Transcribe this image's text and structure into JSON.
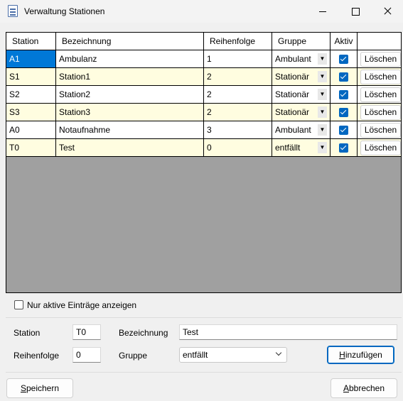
{
  "window": {
    "title": "Verwaltung Stationen"
  },
  "grid": {
    "headers": [
      "Station",
      "Bezeichnung",
      "Reihenfolge",
      "Gruppe",
      "Aktiv",
      ""
    ],
    "rows": [
      {
        "station": "A1",
        "bezeichnung": "Ambulanz",
        "reihenfolge": "1",
        "gruppe": "Ambulant",
        "aktiv": true,
        "action": "Löschen"
      },
      {
        "station": "S1",
        "bezeichnung": "Station1",
        "reihenfolge": "2",
        "gruppe": "Stationär",
        "aktiv": true,
        "action": "Löschen"
      },
      {
        "station": "S2",
        "bezeichnung": "Station2",
        "reihenfolge": "2",
        "gruppe": "Stationär",
        "aktiv": true,
        "action": "Löschen"
      },
      {
        "station": "S3",
        "bezeichnung": "Station3",
        "reihenfolge": "2",
        "gruppe": "Stationär",
        "aktiv": true,
        "action": "Löschen"
      },
      {
        "station": "A0",
        "bezeichnung": "Notaufnahme",
        "reihenfolge": "3",
        "gruppe": "Ambulant",
        "aktiv": true,
        "action": "Löschen"
      },
      {
        "station": "T0",
        "bezeichnung": "Test",
        "reihenfolge": "0",
        "gruppe": "entfällt",
        "aktiv": true,
        "action": "Löschen"
      }
    ]
  },
  "filter": {
    "label": "Nur aktive Einträge anzeigen",
    "checked": false
  },
  "form": {
    "station_label": "Station",
    "station_value": "T0",
    "bezeichnung_label": "Bezeichnung",
    "bezeichnung_value": "Test",
    "reihenfolge_label": "Reihenfolge",
    "reihenfolge_value": "0",
    "gruppe_label": "Gruppe",
    "gruppe_value": "entfällt",
    "add_button": {
      "mnemonic": "H",
      "rest": "inzufügen"
    }
  },
  "footer": {
    "save_button": {
      "mnemonic": "S",
      "rest": "peichern"
    },
    "cancel_button": {
      "mnemonic": "A",
      "rest": "bbrechen"
    }
  },
  "colors": {
    "accent": "#0067c0",
    "selection": "#0078d7",
    "row_alt": "#fffde0",
    "grid_empty": "#a0a0a0"
  }
}
